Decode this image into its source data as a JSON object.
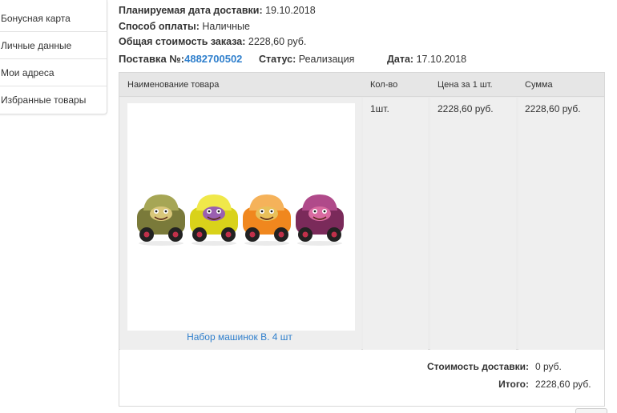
{
  "sidebar": {
    "items": [
      {
        "label": "Бонусная карта"
      },
      {
        "label": "Личные данные"
      },
      {
        "label": "Мои адреса"
      },
      {
        "label": "Избранные товары"
      }
    ]
  },
  "order": {
    "delivery_date_label": "Планируемая дата доставки:",
    "delivery_date": "19.10.2018",
    "payment_label": "Способ оплаты:",
    "payment": "Наличные",
    "total_label": "Общая стоимость заказа:",
    "total": "2228,60 руб."
  },
  "shipment": {
    "title": "Поставка №:",
    "number": "4882700502",
    "status_label": "Статус:",
    "status": "Реализация",
    "date_label": "Дата:",
    "date": "17.10.2018"
  },
  "table": {
    "headers": {
      "name": "Наименование товара",
      "qty": "Кол-во",
      "price": "Цена за 1 шт.",
      "sum": "Сумма"
    },
    "rows": [
      {
        "name": "Набор машинок B. 4 шт",
        "qty": "1шт.",
        "price": "2228,60 руб.",
        "sum": "2228,60 руб."
      }
    ]
  },
  "totals": {
    "delivery_label": "Стоимость доставки:",
    "delivery_value": "0 руб.",
    "total_label": "Итого:",
    "total_value": "2228,60 руб."
  },
  "product_image": {
    "cars": [
      {
        "body": "#7a7a3a",
        "accent": "#a6a655",
        "face": "#d9c77a"
      },
      {
        "body": "#d9d21a",
        "accent": "#f0e84a",
        "face": "#9a5fb0"
      },
      {
        "body": "#f0871e",
        "accent": "#f5b25a",
        "face": "#e8c05a"
      },
      {
        "body": "#7a2a5a",
        "accent": "#b04a8a",
        "face": "#d96aa0"
      }
    ]
  }
}
